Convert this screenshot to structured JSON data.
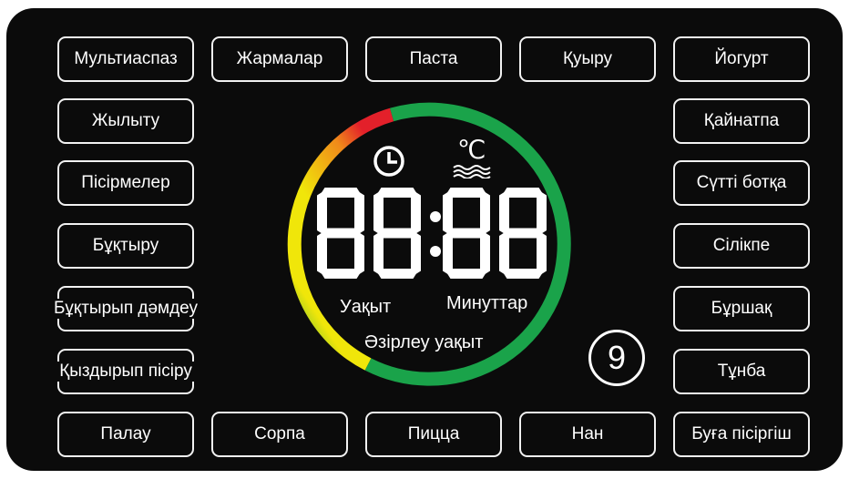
{
  "top_row": [
    "Мультиаспаз",
    "Жармалар",
    "Паста",
    "Қуыру",
    "Йогурт"
  ],
  "left_column": [
    "Жылыту",
    "Пісірмелер",
    "Бұқтыру",
    "Бұқтырып дәмдеу",
    "Қыздырып пісіру"
  ],
  "right_column": [
    "Қайнатпа",
    "Сүтті ботқа",
    "Сілікпе",
    "Бұршақ",
    "Тұнба"
  ],
  "bottom_row": [
    "Палау",
    "Сорпа",
    "Пицца",
    "Нан",
    "Буға пісіргіш"
  ],
  "display": {
    "digits": "88:88",
    "hours_label": "Уақыт",
    "minutes_label": "Минуттар",
    "cook_time_label": "Әзірлеу уақыт",
    "temperature_unit": "℃",
    "clock_icon": "clock-icon",
    "heat_icon": "temperature-icon"
  },
  "number_badge": "9",
  "colors": {
    "panel": "#0b0b0b",
    "ring_yellow": "#f0e60a",
    "ring_red": "#e3202a",
    "ring_green": "#1aa34a",
    "text": "#ffffff"
  }
}
